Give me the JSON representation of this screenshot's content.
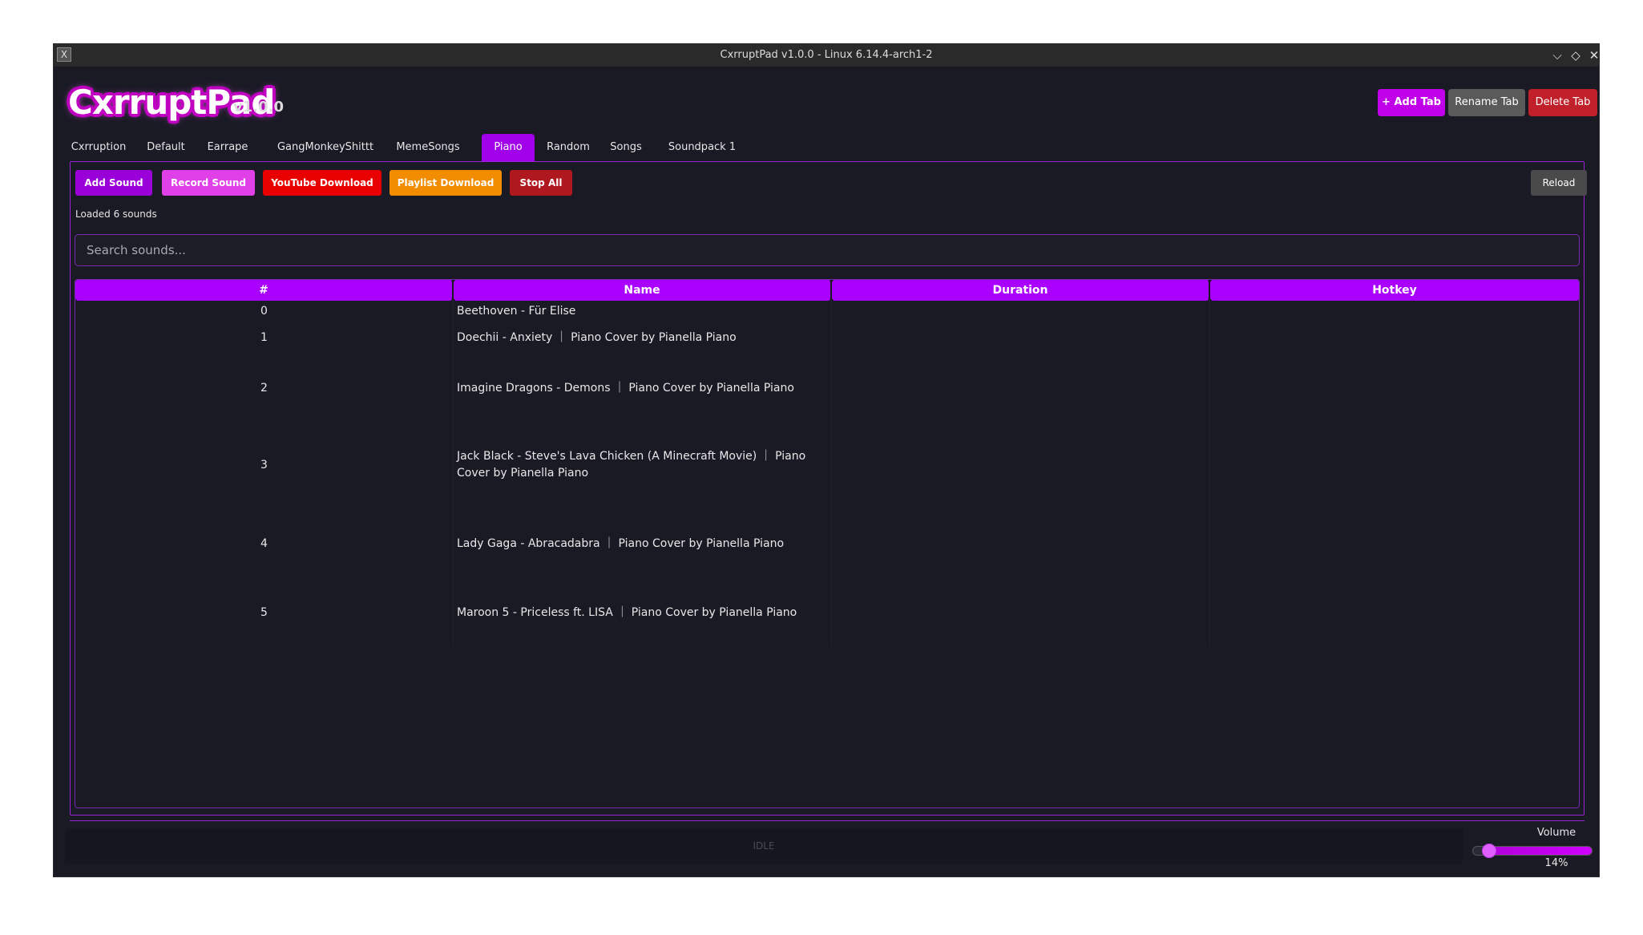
{
  "window": {
    "title": "CxrruptPad v1.0.0 - Linux 6.14.4-arch1-2",
    "app_icon": "X"
  },
  "logo": {
    "text": "CxrruptPad",
    "version": "v1.0.0"
  },
  "header_buttons": {
    "add_tab": "+ Add Tab",
    "rename_tab": "Rename Tab",
    "delete_tab": "Delete Tab"
  },
  "tabs": [
    {
      "label": "Cxrruption"
    },
    {
      "label": "Default"
    },
    {
      "label": "Earrape"
    },
    {
      "label": "GangMonkeyShittt"
    },
    {
      "label": "MemeSongs"
    },
    {
      "label": "Piano",
      "active": true
    },
    {
      "label": "Random"
    },
    {
      "label": "Songs"
    },
    {
      "label": "Soundpack 1"
    }
  ],
  "toolbar": {
    "add_sound": "Add Sound",
    "record_sound": "Record Sound",
    "youtube_download": "YouTube Download",
    "playlist_download": "Playlist Download",
    "stop_all": "Stop All",
    "reload": "Reload"
  },
  "status_text": "Loaded 6 sounds",
  "search": {
    "placeholder": "Search sounds..."
  },
  "table": {
    "headers": {
      "num": "#",
      "name": "Name",
      "duration": "Duration",
      "hotkey": "Hotkey"
    },
    "rows": [
      {
        "num": "0",
        "name": "Beethoven - Für Elise",
        "duration": "",
        "hotkey": ""
      },
      {
        "num": "1",
        "name": "Doechii - Anxiety ｜ Piano Cover by Pianella Piano",
        "duration": "",
        "hotkey": ""
      },
      {
        "num": "2",
        "name": "Imagine Dragons - Demons ｜ Piano Cover by Pianella Piano",
        "duration": "",
        "hotkey": ""
      },
      {
        "num": "3",
        "name": "Jack Black - Steve's Lava Chicken (A Minecraft Movie) ｜ Piano Cover by Pianella Piano",
        "duration": "",
        "hotkey": ""
      },
      {
        "num": "4",
        "name": "Lady Gaga - Abracadabra ｜ Piano Cover by Pianella Piano",
        "duration": "",
        "hotkey": ""
      },
      {
        "num": "5",
        "name": "Maroon 5 - Priceless ft. LISA ｜ Piano Cover by Pianella Piano",
        "duration": "",
        "hotkey": ""
      }
    ]
  },
  "status_bar": {
    "text": "IDLE"
  },
  "volume": {
    "label": "Volume",
    "value": 14,
    "display": "14%"
  },
  "colors": {
    "accent": "#a900ff",
    "add_sound": "#9a00d8",
    "record_sound": "#e040e8",
    "youtube_download": "#e80000",
    "playlist_download": "#f28c00",
    "stop_all": "#b01820",
    "reload": "#4a4a4a",
    "add_tab": "#c000e8",
    "rename_tab": "#5a5a5a",
    "delete_tab": "#c0202a"
  }
}
